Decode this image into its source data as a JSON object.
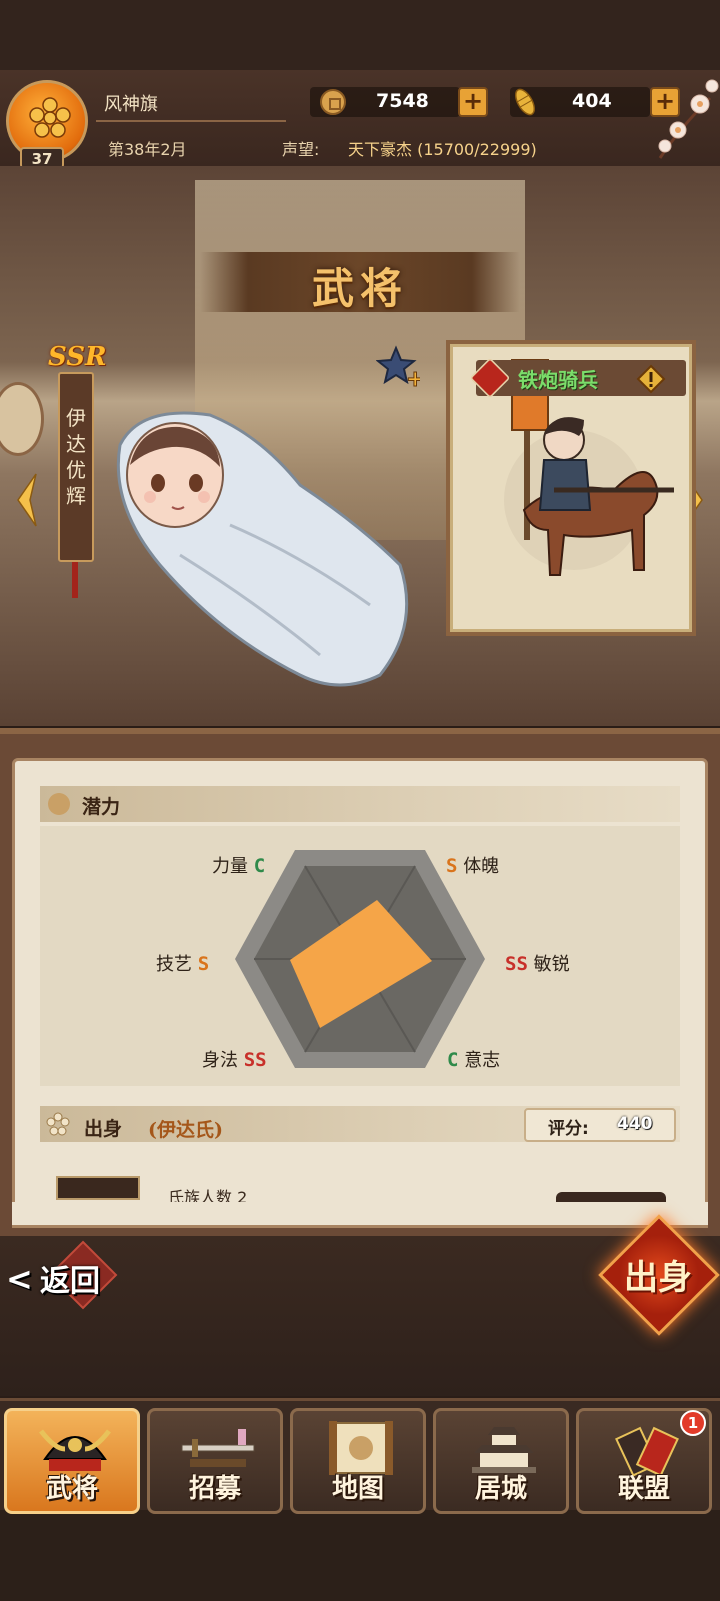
{
  "header": {
    "player_name": "风神旗",
    "level": "37",
    "game_date": "第38年2月",
    "prestige_label": "声望:",
    "prestige_value": "天下豪杰 (15700/22999)",
    "coins": "7548",
    "gold": "404"
  },
  "page": {
    "title": "武将"
  },
  "general": {
    "rarity": "SSR",
    "name": "伊达优辉"
  },
  "troop": {
    "name": "铁炮骑兵"
  },
  "potential": {
    "title": "潜力",
    "stats": [
      {
        "label": "力量",
        "grade": "C"
      },
      {
        "label": "体魄",
        "grade": "S"
      },
      {
        "label": "敏锐",
        "grade": "SS"
      },
      {
        "label": "意志",
        "grade": "C"
      },
      {
        "label": "身法",
        "grade": "SS"
      },
      {
        "label": "技艺",
        "grade": "S"
      }
    ],
    "grade_colors": {
      "C": "#2f8a4a",
      "S": "#d9741c",
      "SS": "#c8302a"
    },
    "fill_color": "#f5a548"
  },
  "origin": {
    "title": "出身",
    "clan": "(伊达氏)",
    "score_label": "评分:",
    "score_value": "440",
    "clan_count": "氏族人数 2"
  },
  "actions": {
    "back_label": "返回",
    "origin_button_label": "出身"
  },
  "nav": {
    "tabs": [
      {
        "label": "武将",
        "icon": "samurai-helmet-icon",
        "active": true
      },
      {
        "label": "招募",
        "icon": "katana-icon",
        "active": false
      },
      {
        "label": "地图",
        "icon": "scroll-map-icon",
        "active": false
      },
      {
        "label": "居城",
        "icon": "castle-icon",
        "active": false
      },
      {
        "label": "联盟",
        "icon": "alliance-banner-icon",
        "active": false
      }
    ],
    "alliance_badge": "1"
  }
}
